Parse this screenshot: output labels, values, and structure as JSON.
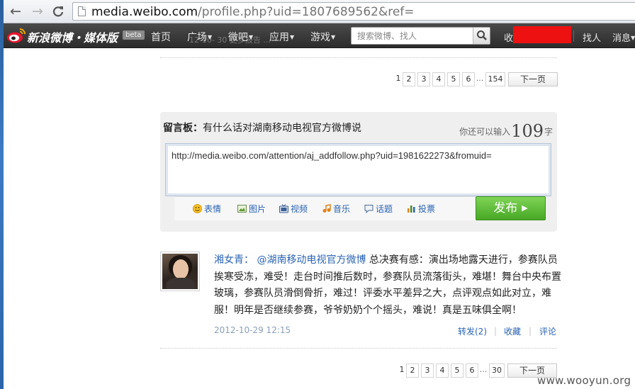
{
  "browser": {
    "back_label": "←",
    "forward_label": "→",
    "reload_label": "C",
    "url_host": "media.weibo.com",
    "url_path": "/profile.php?uid=1807689562&ref="
  },
  "topnav": {
    "brand": "新浪微博・媒体版",
    "beta": "beta",
    "menu": [
      "首页",
      "广场",
      "微吧",
      "应用",
      "游戏"
    ],
    "ghost_text": "12-10-   30 更多报告  ...",
    "search_placeholder": "搜索微博、找人",
    "right_items": [
      "收",
      "找人",
      "消息"
    ]
  },
  "pager_top": {
    "pages": [
      "1",
      "2",
      "3",
      "4",
      "5",
      "6",
      "...",
      "154"
    ],
    "next": "下一页"
  },
  "board": {
    "title_bold": "留言板：",
    "title_rest": "有什么话对湖南移动电视官方微博说",
    "remain_prefix": "你还可以输入",
    "remain_count": "109",
    "remain_suffix": "字",
    "input_value": "http://media.weibo.com/attention/aj_addfollow.php?uid=1981622273&fromuid=",
    "tools": [
      "表情",
      "图片",
      "视频",
      "音乐",
      "话题",
      "投票"
    ],
    "publish": "发布"
  },
  "feed": {
    "author": "湘女青：",
    "mention": "@湖南移动电视官方微博",
    "text": "总决赛有感：演出场地露天进行，参赛队员挨寒受冻，难受！走台时间推后数时，参赛队员流落街头，难堪！舞台中央布置玻璃，参赛队员滑倒骨折，难过！评委水平差异之大，点评观点如此对立，难服！明年是否继续参赛，爷爷奶奶个个摇头，难说！真是五味俱全啊！",
    "time": "2012-10-29 12:15",
    "repost": "转发(2)",
    "favorite": "收藏",
    "comment": "评论",
    "sep": "|"
  },
  "pager_bottom": {
    "pages": [
      "1",
      "2",
      "3",
      "4",
      "5",
      "6",
      "...",
      "30"
    ],
    "next": "下一页"
  },
  "watermark": "www.wooyun.org"
}
